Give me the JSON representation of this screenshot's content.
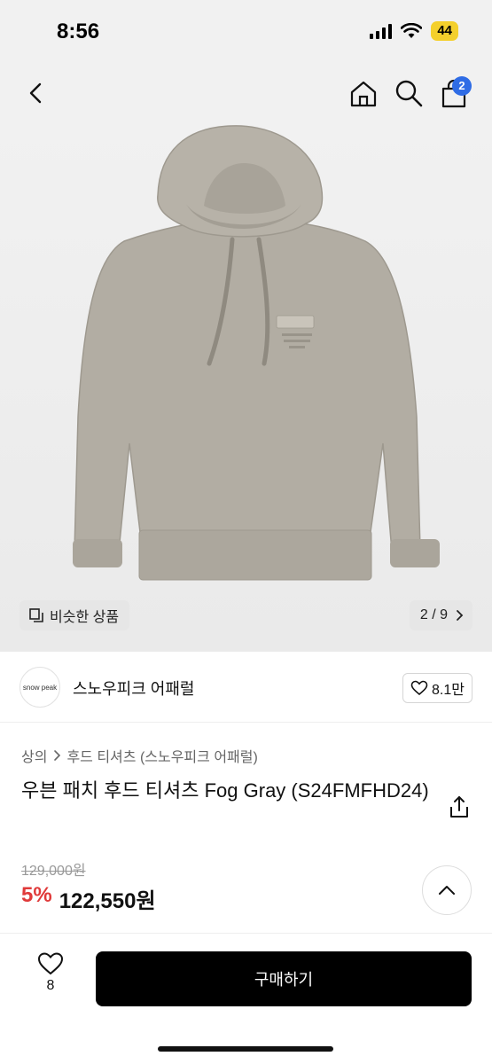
{
  "status_bar": {
    "time": "8:56",
    "battery": "44"
  },
  "nav": {
    "cart_badge": "2"
  },
  "gallery": {
    "similar_label": "비슷한 상품",
    "page_indicator": "2 / 9"
  },
  "brand": {
    "logo_text": "snow peak",
    "name": "스노우피크 어패럴",
    "likes": "8.1만"
  },
  "breadcrumb": {
    "category": "상의",
    "subcategory": "후드 티셔츠 (스노우피크 어패럴)"
  },
  "product": {
    "title": "우븐 패치 후드 티셔츠 Fog Gray (S24FMFHD24)",
    "original_price": "129,000원",
    "discount": "5%",
    "sale_price": "122,550원"
  },
  "bottom": {
    "wish_count": "8",
    "buy_label": "구매하기"
  },
  "colors": {
    "accent_blue": "#2f6ce5",
    "discount_red": "#e03a3a",
    "hoodie": "#b2ada3"
  }
}
